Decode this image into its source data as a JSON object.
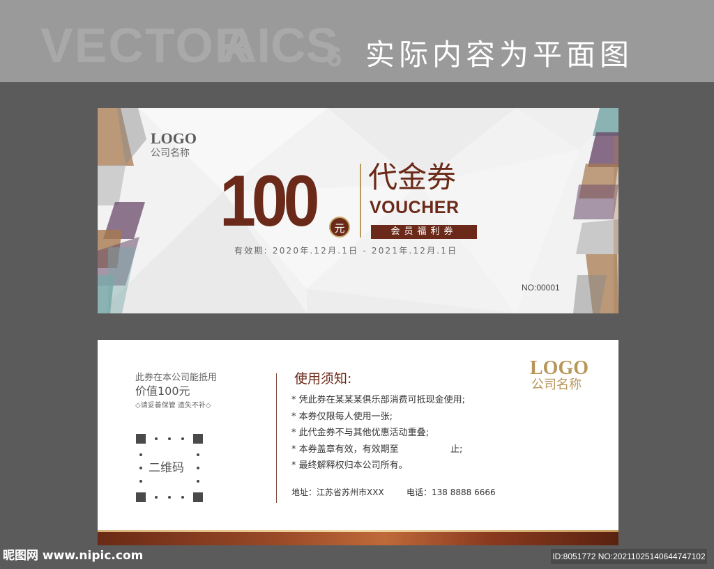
{
  "watermark": {
    "vector": "VECTOR",
    "aics": "AICS",
    "version": "6",
    "note": "实际内容为平面图"
  },
  "front": {
    "logo": "LOGO",
    "company": "公司名称",
    "amount": "100",
    "unit": "元",
    "title": "代金券",
    "title_en": "VOUCHER",
    "member_label": "会员福利券",
    "validity": "有效期: 2020年.12月.1日 - 2021年.12月.1日",
    "serial": "NO:00001"
  },
  "back": {
    "left_line1": "此券在本公司能抵用",
    "left_line2": "价值100元",
    "left_line3": "◇请妥善保管 遗失不补◇",
    "qr_label": "二维码",
    "rules_title": "使用须知:",
    "rules": [
      "* 凭此券在某某某俱乐部消费可抵现金使用;",
      "* 本券仅限每人使用一张;",
      "* 此代金券不与其他优惠活动重叠;",
      "* 本券盖章有效，有效期至                  止;",
      "* 最终解释权归本公司所有。"
    ],
    "address": "地址：江苏省苏州市XXX",
    "phone": "电话：138 8888 6666",
    "logo": "LOGO",
    "company": "公司名称"
  },
  "footer": {
    "site": "昵图网 www.nipic.com",
    "id": "ID:8051772 NO:20211025140644747102"
  },
  "colors": {
    "brand_brown": "#6b2a19",
    "gold": "#b8965a",
    "teal": "#7aa8a8",
    "purple": "#6a4a6a"
  }
}
